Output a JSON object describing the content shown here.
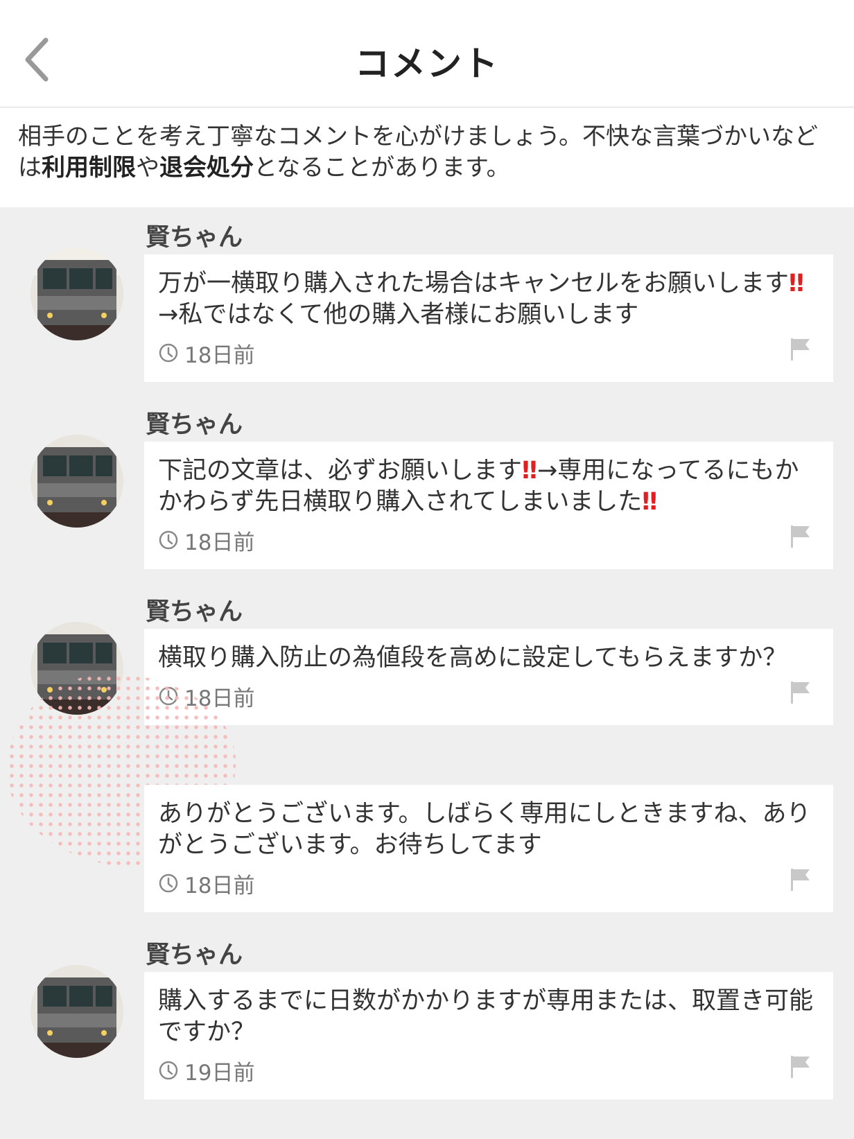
{
  "header": {
    "title": "コメント"
  },
  "notice": {
    "part1": "相手のことを考え丁寧なコメントを心がけましょう。不快な言葉づかいなどは",
    "bold1": "利用制限",
    "part2": "や",
    "bold2": "退会処分",
    "part3": "となることがあります。"
  },
  "comments": [
    {
      "user": "賢ちゃん",
      "text_a": "万が一横取り購入された場合はキャンセルをお願いします",
      "bang_a": "‼",
      "text_b": "→私ではなくて他の購入者様にお願いします",
      "bang_b": "",
      "time": "18日前"
    },
    {
      "user": "賢ちゃん",
      "text_a": "下記の文章は、必ずお願いします",
      "bang_a": "‼",
      "text_b": "→専用になってるにもかかわらず先日横取り購入されてしまいました",
      "bang_b": "‼",
      "time": "18日前"
    },
    {
      "user": "賢ちゃん",
      "text_a": "横取り購入防止の為値段を高めに設定してもらえますか？",
      "bang_a": "",
      "text_b": "",
      "bang_b": "",
      "time": "18日前"
    },
    {
      "user": "",
      "text_a": "ありがとうございます。しばらく専用にしときますね、ありがとうございます。お待ちしてます",
      "bang_a": "",
      "text_b": "",
      "bang_b": "",
      "time": "18日前"
    },
    {
      "user": "賢ちゃん",
      "text_a": "購入するまでに日数がかかりますが専用または、取置き可能ですか？",
      "bang_a": "",
      "text_b": "",
      "bang_b": "",
      "time": "19日前"
    }
  ],
  "icons": {
    "back": "chevron-left-icon",
    "clock": "clock-icon",
    "flag": "flag-icon"
  },
  "colors": {
    "background": "#efefef",
    "alert": "#e02020"
  }
}
